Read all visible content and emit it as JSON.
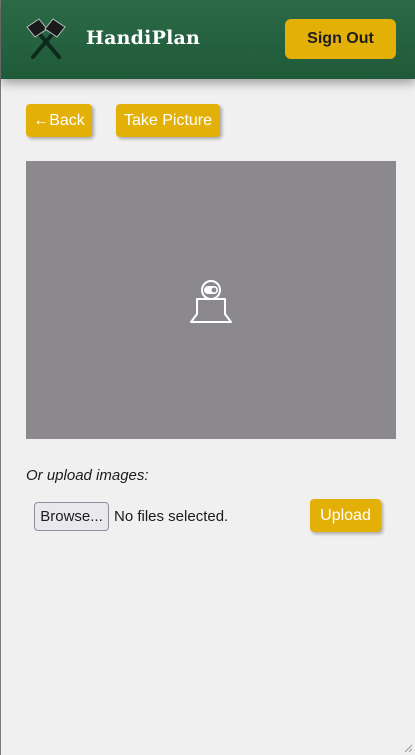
{
  "header": {
    "app_title": "HandiPlan",
    "logo_icon": "crossed-hammers-icon",
    "sign_out_label": "Sign Out"
  },
  "toolbar": {
    "back_label": "←Back",
    "take_picture_label": "Take Picture"
  },
  "camera": {
    "placeholder_icon": "webcam-icon"
  },
  "upload": {
    "label": "Or upload images:",
    "browse_label": "Browse...",
    "file_status": "No files selected.",
    "upload_label": "Upload"
  },
  "colors": {
    "header_green": "#2c6a47",
    "accent_yellow": "#e3b008",
    "camera_gray": "#8b898e",
    "page_background": "#f0f0f0"
  }
}
